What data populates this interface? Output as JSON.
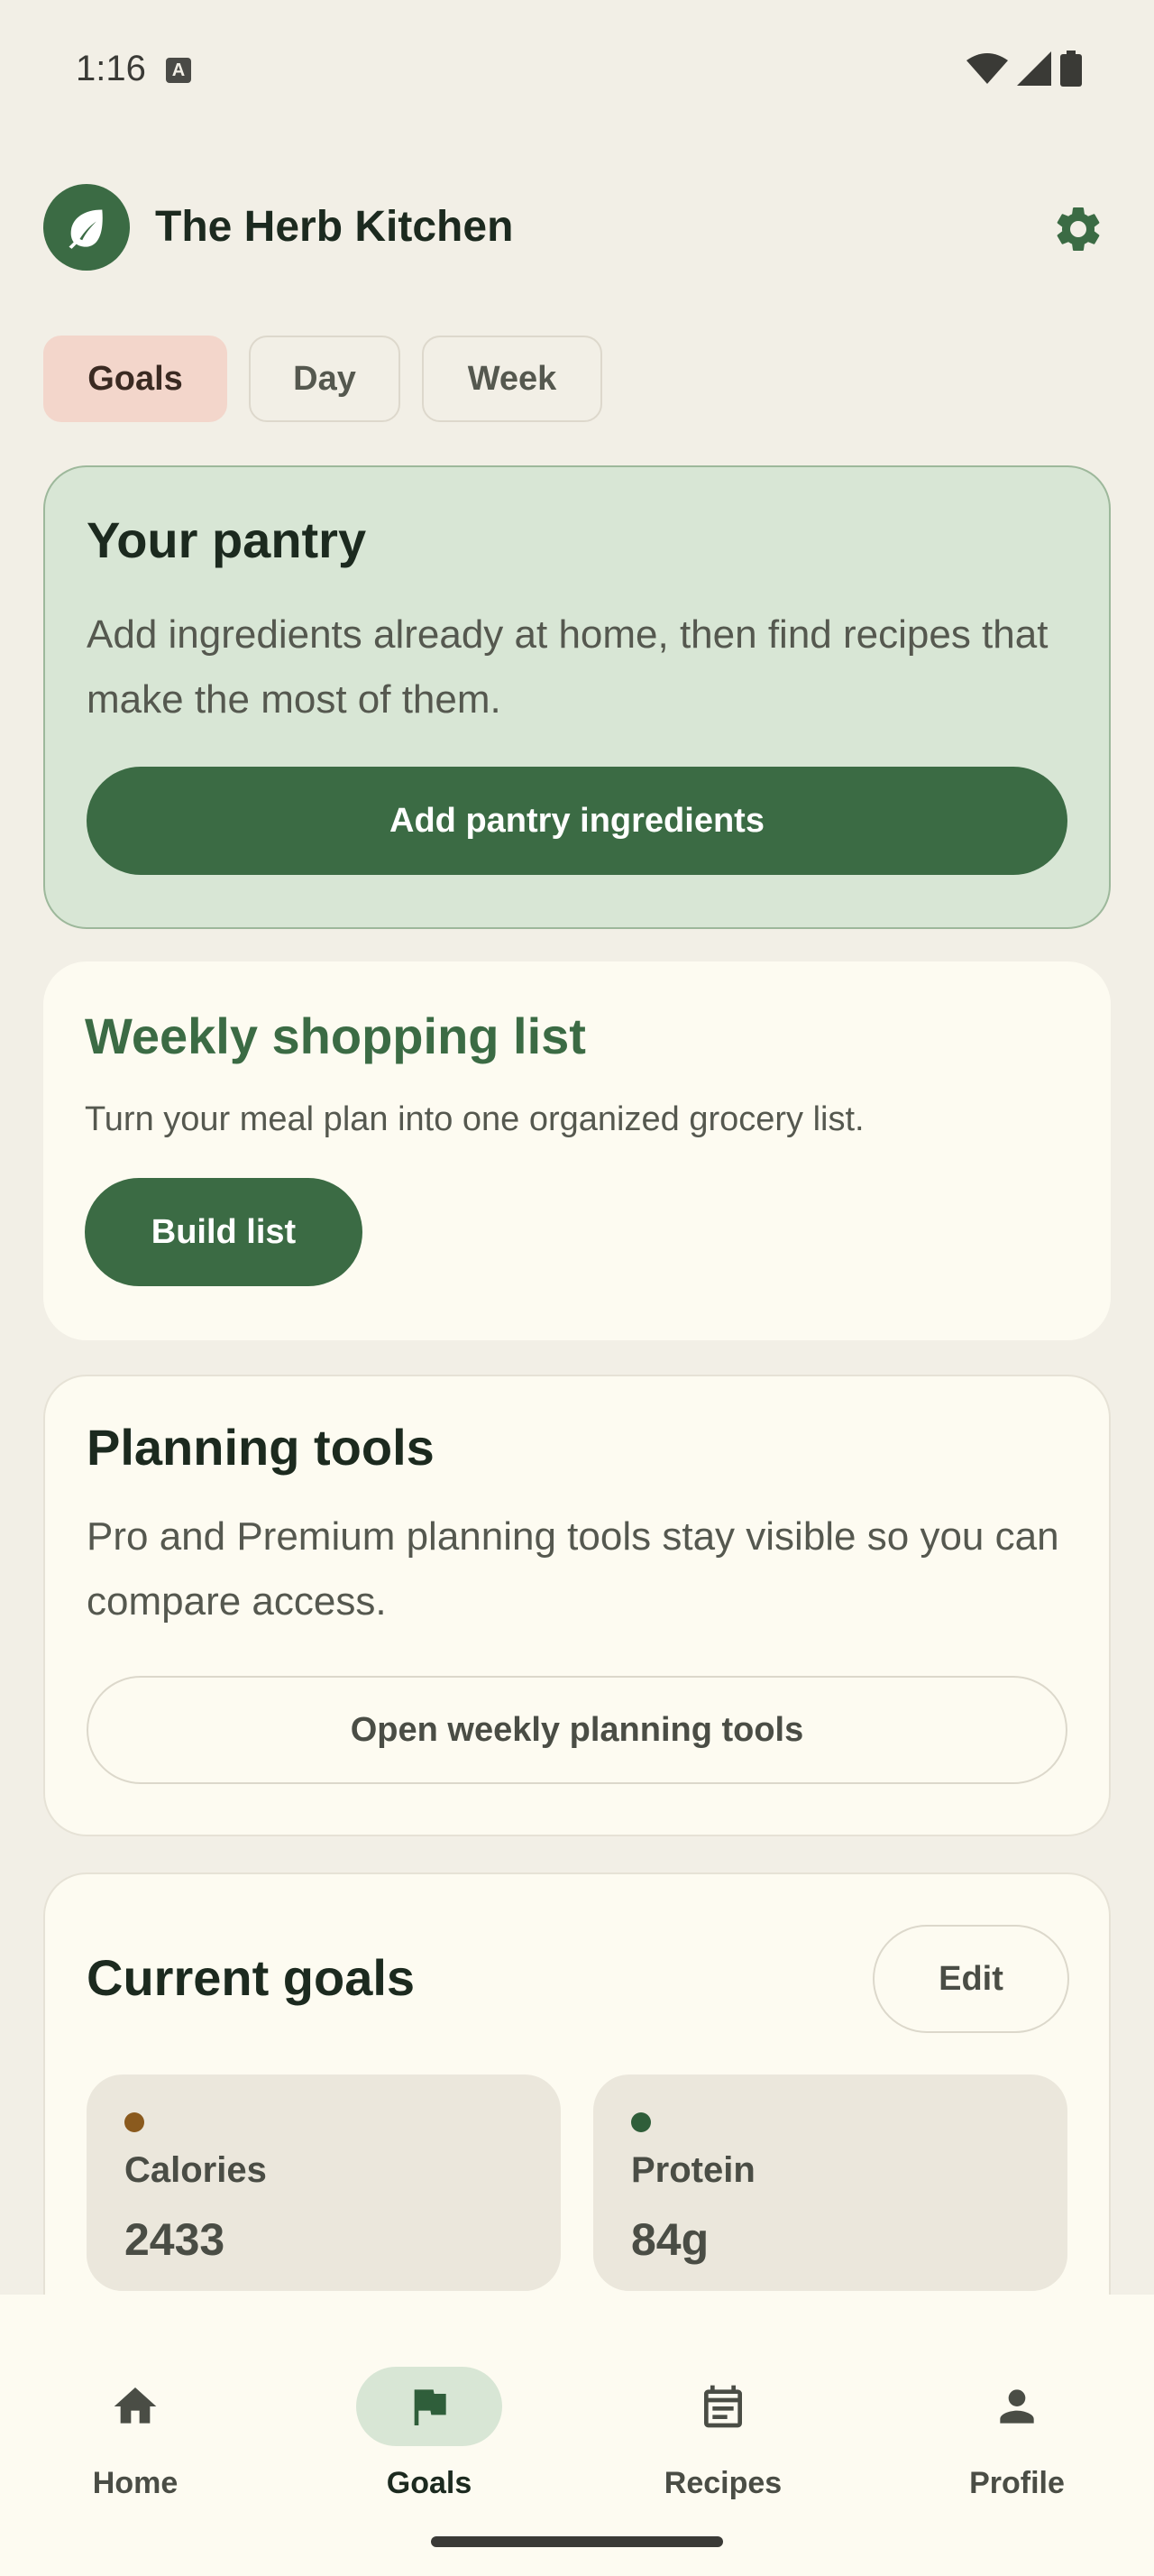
{
  "status_bar": {
    "time": "1:16",
    "notification_glyph": "A"
  },
  "header": {
    "title": "The Herb Kitchen",
    "logo_icon": "leaf-icon",
    "settings_icon": "gear-icon"
  },
  "tabs": [
    {
      "label": "Goals",
      "active": true
    },
    {
      "label": "Day",
      "active": false
    },
    {
      "label": "Week",
      "active": false
    }
  ],
  "pantry_card": {
    "title": "Your pantry",
    "description": "Add ingredients already at home, then find recipes that make the most of them.",
    "button": "Add pantry ingredients"
  },
  "shopping_card": {
    "title": "Weekly shopping list",
    "description": "Turn your meal plan into one organized grocery list.",
    "button": "Build list"
  },
  "planning_card": {
    "title": "Planning tools",
    "description": "Pro and Premium planning tools stay visible so you can compare access.",
    "button": "Open weekly planning tools"
  },
  "goals_card": {
    "title": "Current goals",
    "edit_button": "Edit",
    "goals": [
      {
        "label": "Calories",
        "value": "2433",
        "dot_color": "#8A5A1E"
      },
      {
        "label": "Protein",
        "value": "84g",
        "dot_color": "#2F5E3A"
      }
    ]
  },
  "bottom_nav": [
    {
      "label": "Home",
      "icon": "home-icon",
      "active": false
    },
    {
      "label": "Goals",
      "icon": "flag-icon",
      "active": true
    },
    {
      "label": "Recipes",
      "icon": "calendar-icon",
      "active": false
    },
    {
      "label": "Profile",
      "icon": "person-icon",
      "active": false
    }
  ],
  "colors": {
    "accent": "#3B6B44",
    "background": "#F2EFE6",
    "active_tab": "#F3D6CB",
    "pantry_card": "#D8E6D5"
  }
}
